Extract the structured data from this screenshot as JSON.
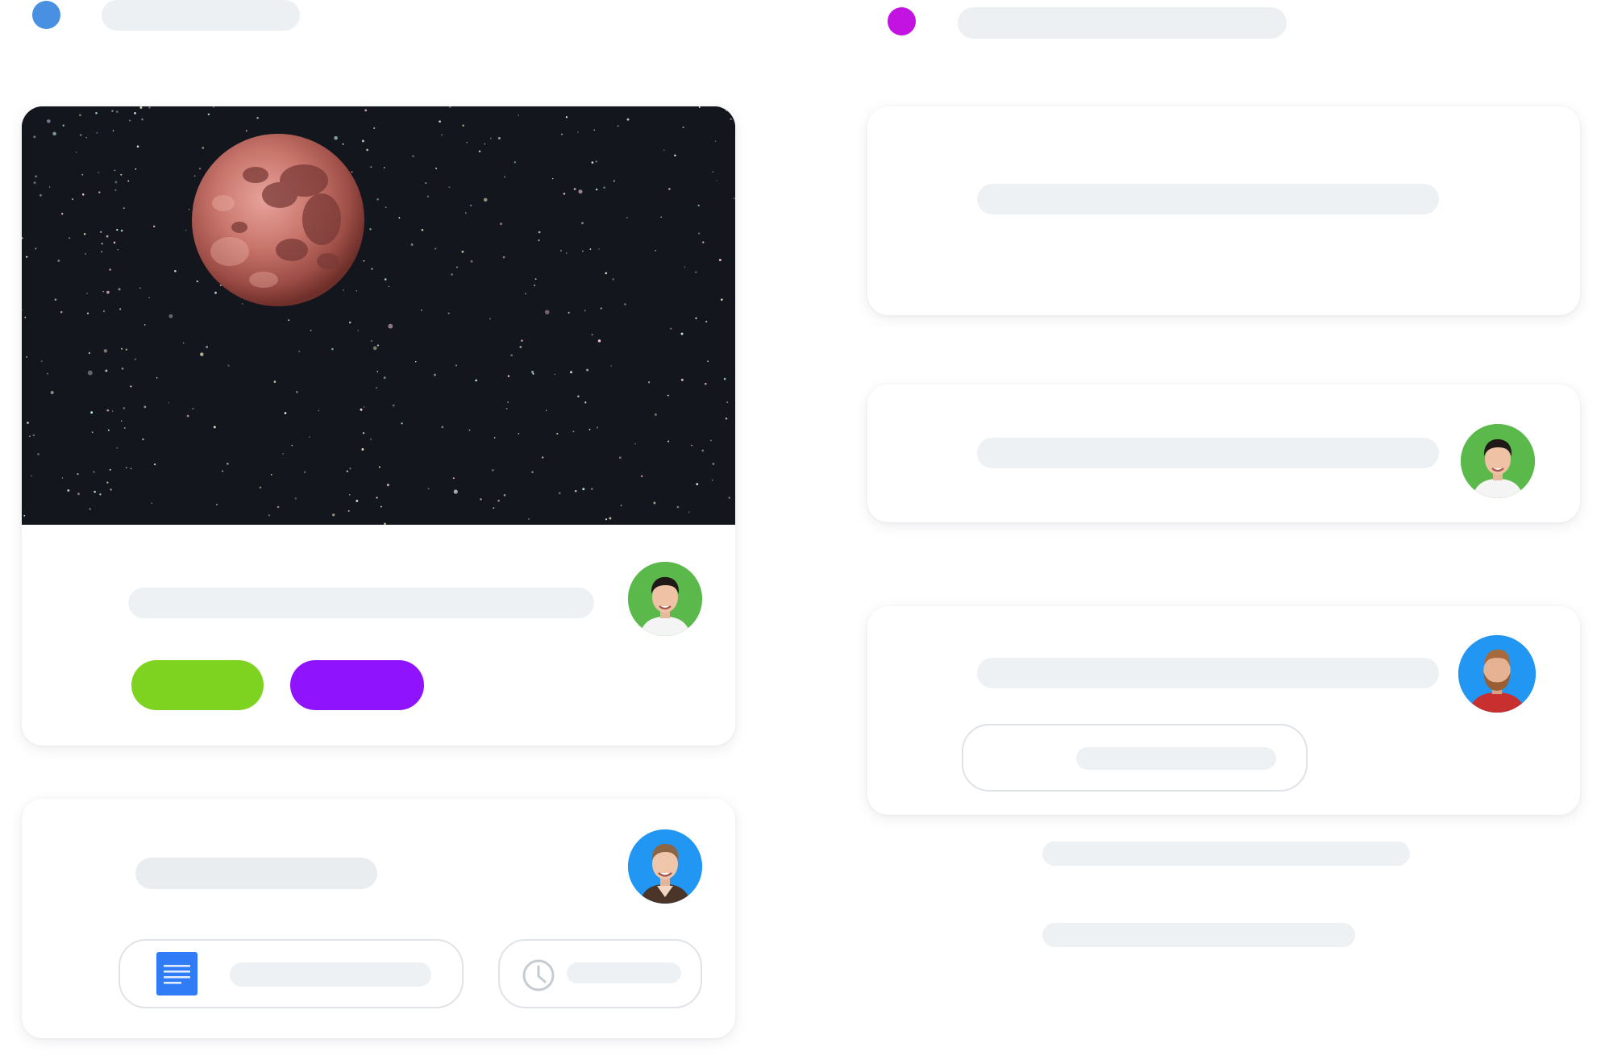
{
  "columns": [
    {
      "header_dot_color": "#4a90e2"
    },
    {
      "header_dot_color": "#c313e0"
    }
  ],
  "hero_card": {
    "image_icon": "moon-night-sky-image",
    "avatar_icon": "man-avatar-green",
    "tags": [
      {
        "color": "#7ed321"
      },
      {
        "color": "#9013fe"
      }
    ]
  },
  "document_card": {
    "avatar_icon": "man-avatar-blue",
    "document_icon": "document-icon",
    "clock_icon": "clock-icon"
  },
  "right_cards": [
    {
      "avatar_icon": ""
    },
    {
      "avatar_icon": "man-avatar-green"
    },
    {
      "avatar_icon": "bearded-man-avatar-blue"
    }
  ],
  "colors": {
    "placeholder": "#edf0f2",
    "avatar_green": "#5ab94a",
    "avatar_blue": "#2196f3",
    "doc_blue": "#2f7cf6"
  }
}
